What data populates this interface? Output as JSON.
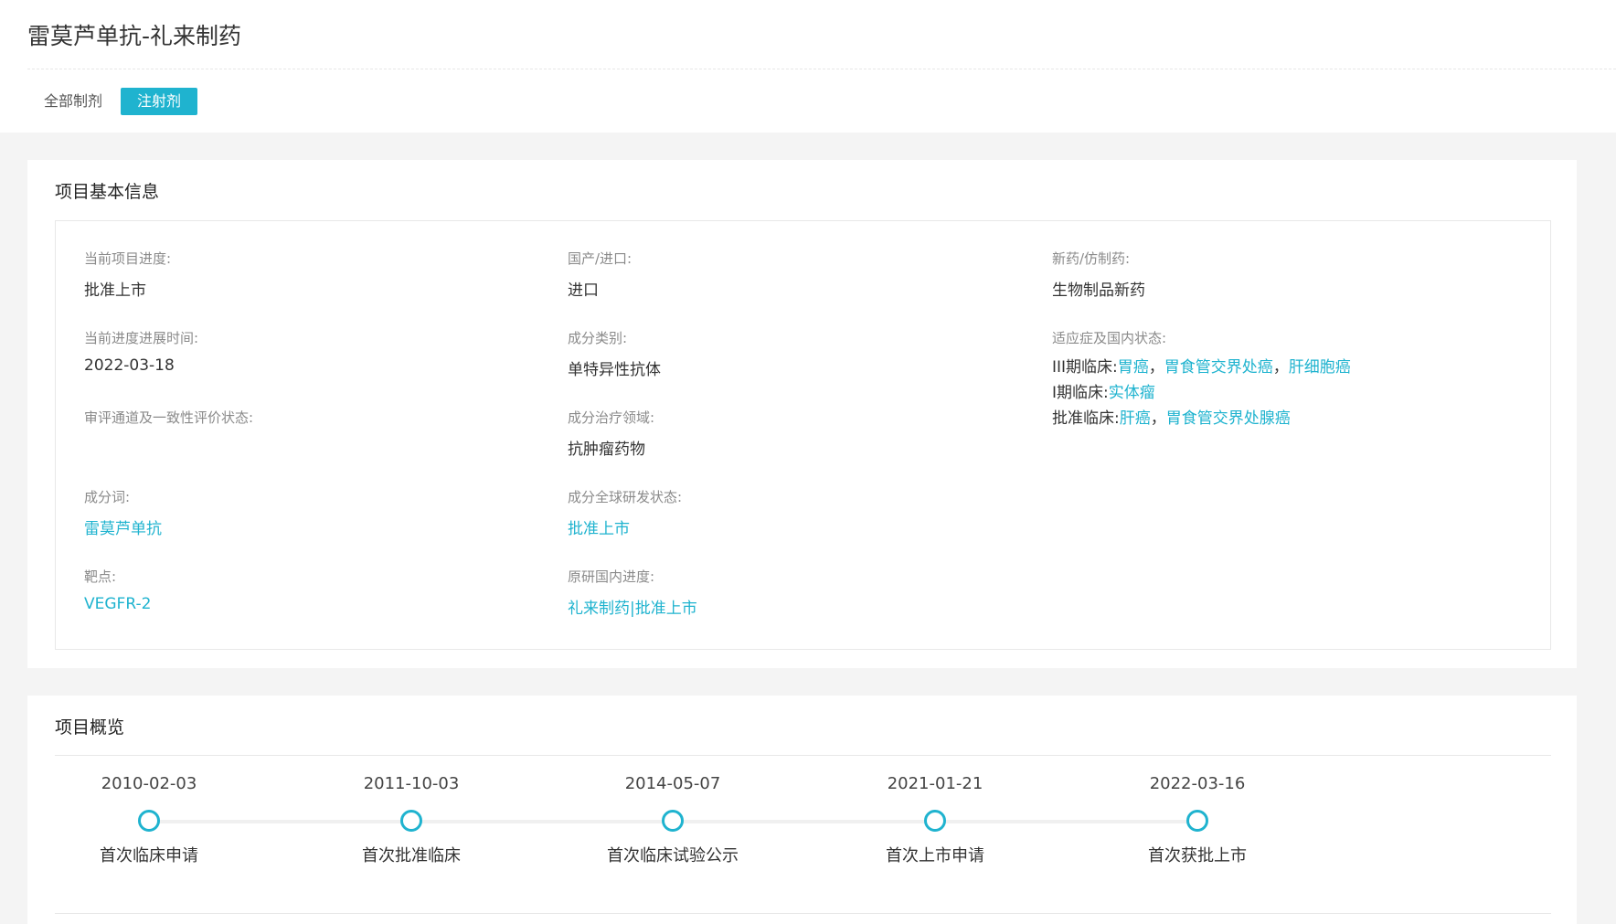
{
  "header": {
    "title": "雷莫芦单抗-礼来制药",
    "tabs": [
      {
        "label": "全部制剂",
        "active": false
      },
      {
        "label": "注射剂",
        "active": true
      }
    ]
  },
  "basic_info": {
    "section_title": "项目基本信息",
    "current_progress": {
      "label": "当前项目进度:",
      "value": "批准上市"
    },
    "domestic_import": {
      "label": "国产/进口:",
      "value": "进口"
    },
    "new_generic": {
      "label": "新药/仿制药:",
      "value": "生物制品新药"
    },
    "progress_time": {
      "label": "当前进度进展时间:",
      "value": "2022-03-18"
    },
    "ingredient_category": {
      "label": "成分类别:",
      "value": "单特异性抗体"
    },
    "indications": {
      "label": "适应症及国内状态:",
      "phase3": {
        "prefix": "III期临床:",
        "items": [
          "胃癌",
          "胃食管交界处癌",
          "肝细胞癌"
        ]
      },
      "phase1": {
        "prefix": "I期临床:",
        "items": [
          "实体瘤"
        ]
      },
      "approved_clinical": {
        "prefix": "批准临床:",
        "items": [
          "肝癌",
          "胃食管交界处腺癌"
        ]
      }
    },
    "review_channel": {
      "label": "审评通道及一致性评价状态:",
      "value": ""
    },
    "therapeutic_area": {
      "label": "成分治疗领域:",
      "value": "抗肿瘤药物"
    },
    "ingredient_word": {
      "label": "成分词:",
      "value": "雷莫芦单抗"
    },
    "global_status": {
      "label": "成分全球研发状态:",
      "value": "批准上市"
    },
    "target": {
      "label": "靶点:",
      "value": "VEGFR-2"
    },
    "originator_progress": {
      "label": "原研国内进度:",
      "value": "礼来制药|批准上市"
    },
    "link_color": "#1fb3cf"
  },
  "overview": {
    "section_title": "项目概览",
    "milestones": [
      {
        "date": "2010-02-03",
        "label": "首次临床申请"
      },
      {
        "date": "2011-10-03",
        "label": "首次批准临床"
      },
      {
        "date": "2014-05-07",
        "label": "首次临床试验公示"
      },
      {
        "date": "2021-01-21",
        "label": "首次上市申请"
      },
      {
        "date": "2022-03-16",
        "label": "首次获批上市"
      }
    ]
  }
}
